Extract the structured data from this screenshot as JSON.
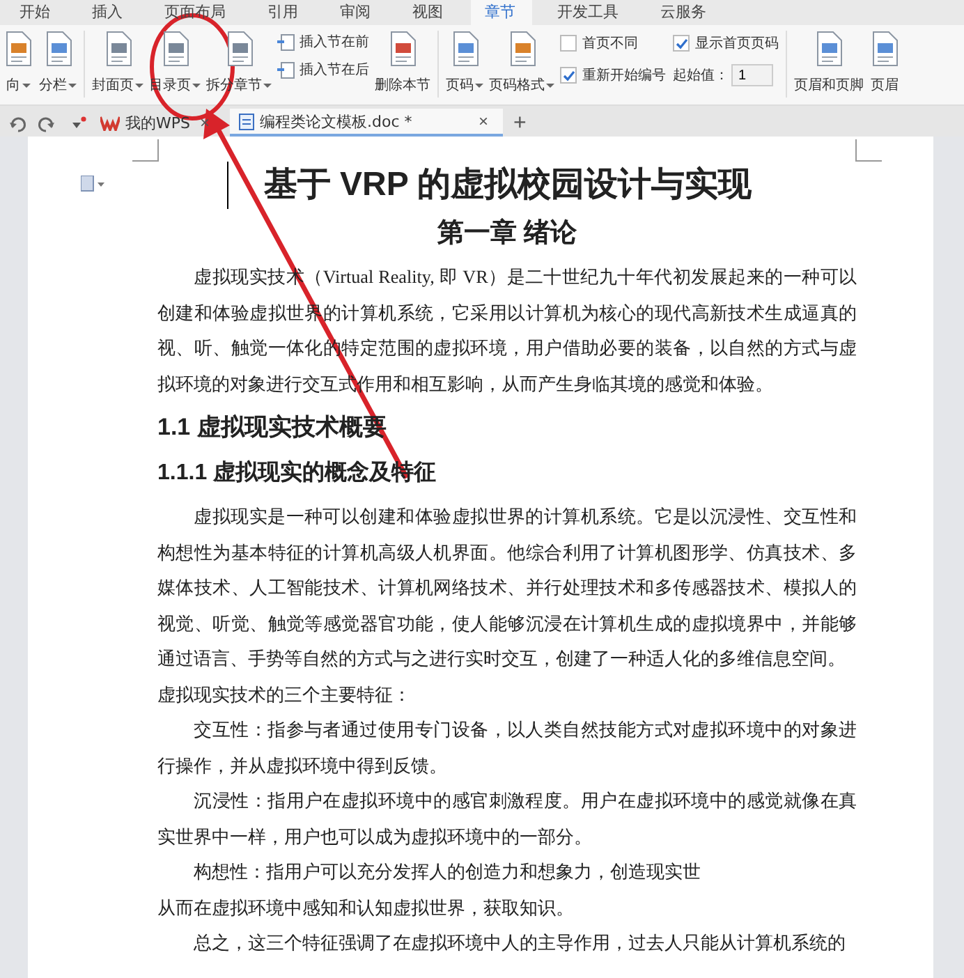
{
  "menu_tabs": [
    {
      "label": "开始",
      "selected": false
    },
    {
      "label": "插入",
      "selected": false
    },
    {
      "label": "页面布局",
      "selected": false
    },
    {
      "label": "引用",
      "selected": false
    },
    {
      "label": "审阅",
      "selected": false
    },
    {
      "label": "视图",
      "selected": false
    },
    {
      "label": "章节",
      "selected": true
    },
    {
      "label": "开发工具",
      "selected": false
    },
    {
      "label": "云服务",
      "selected": false
    }
  ],
  "ribbon": [
    {
      "kind": "big",
      "label": "向",
      "dropdown": true
    },
    {
      "kind": "big",
      "label": "分栏",
      "dropdown": true
    },
    {
      "kind": "separator"
    },
    {
      "kind": "big",
      "label": "封面页",
      "dropdown": true
    },
    {
      "kind": "big",
      "label": "目录页",
      "dropdown": true
    },
    {
      "kind": "big",
      "label": "拆分章节",
      "dropdown": true
    },
    {
      "kind": "stack",
      "items": [
        "插入节在前",
        "插入节在后"
      ]
    },
    {
      "kind": "big",
      "label": "删除本节",
      "dropdown": false
    },
    {
      "kind": "separator"
    },
    {
      "kind": "big",
      "label": "页码",
      "dropdown": true
    },
    {
      "kind": "big",
      "label": "页码格式",
      "dropdown": true
    },
    {
      "kind": "options",
      "items": [
        {
          "kind": "checkbox",
          "label": "首页不同",
          "checked": false
        },
        {
          "kind": "checkbox",
          "label": "显示首页页码",
          "checked": true
        },
        {
          "kind": "checkbox",
          "label": "重新开始编号",
          "checked": true
        },
        {
          "kind": "field",
          "label": "起始值：",
          "value": "1"
        }
      ]
    },
    {
      "kind": "separator"
    },
    {
      "kind": "big",
      "label": "页眉和页脚",
      "dropdown": false
    },
    {
      "kind": "big",
      "label": "页眉",
      "dropdown": false
    }
  ],
  "doc_tabs": [
    {
      "label": "我的WPS",
      "close": "×",
      "selected": false
    },
    {
      "label": "编程类论文模板.doc *",
      "close": "×",
      "selected": true
    }
  ],
  "new_tab": "+",
  "document": [
    {
      "kind": "title",
      "text": "基于 VRP 的虚拟校园设计与实现"
    },
    {
      "kind": "chapter",
      "text": "第一章  绪论"
    },
    {
      "kind": "para",
      "text": "虚拟现实技术（Virtual Reality, 即 VR）是二十世纪九十年代初发展起来的一种可以创建和体验虚拟世界的计算机系统，它采用以计算机为核心的现代高新技术生成逼真的视、听、触觉一体化的特定范围的虚拟环境，用户借助必要的装备，以自然的方式与虚拟环境的对象进行交互式作用和相互影响，从而产生身临其境的感觉和体验。"
    },
    {
      "kind": "h2",
      "text": "1.1  虚拟现实技术概要"
    },
    {
      "kind": "h3",
      "text": "1.1.1  虚拟现实的概念及特征"
    },
    {
      "kind": "para",
      "text": "虚拟现实是一种可以创建和体验虚拟世界的计算机系统。它是以沉浸性、交互性和构想性为基本特征的计算机高级人机界面。他综合利用了计算机图形学、仿真技术、多媒体技术、人工智能技术、计算机网络技术、并行处理技术和多传感器技术、模拟人的视觉、听觉、触觉等感觉器官功能，使人能够沉浸在计算机生成的虚拟境界中，并能够通过语言、手势等自然的方式与之进行实时交互，创建了一种适人化的多维信息空间。"
    },
    {
      "kind": "plain",
      "text": "虚拟现实技术的三个主要特征："
    },
    {
      "kind": "para",
      "text": "交互性：指参与者通过使用专门设备，以人类自然技能方式对虚拟环境中的对象进行操作，并从虚拟环境中得到反馈。"
    },
    {
      "kind": "para",
      "text": "沉浸性：指用户在虚拟环境中的感官刺激程度。用户在虚拟环境中的感觉就像在真实世界中一样，用户也可以成为虚拟环境中的一部分。"
    },
    {
      "kind": "para",
      "text": "构想性：指用户可以充分发挥人的创造力和想象力，创造现实世"
    },
    {
      "kind": "plain",
      "text": "从而在虚拟环境中感知和认知虚拟世界，获取知识。"
    },
    {
      "kind": "para",
      "text": "总之，这三个特征强调了在虚拟环境中人的主导作用，过去人只能从计算机系统的"
    }
  ]
}
